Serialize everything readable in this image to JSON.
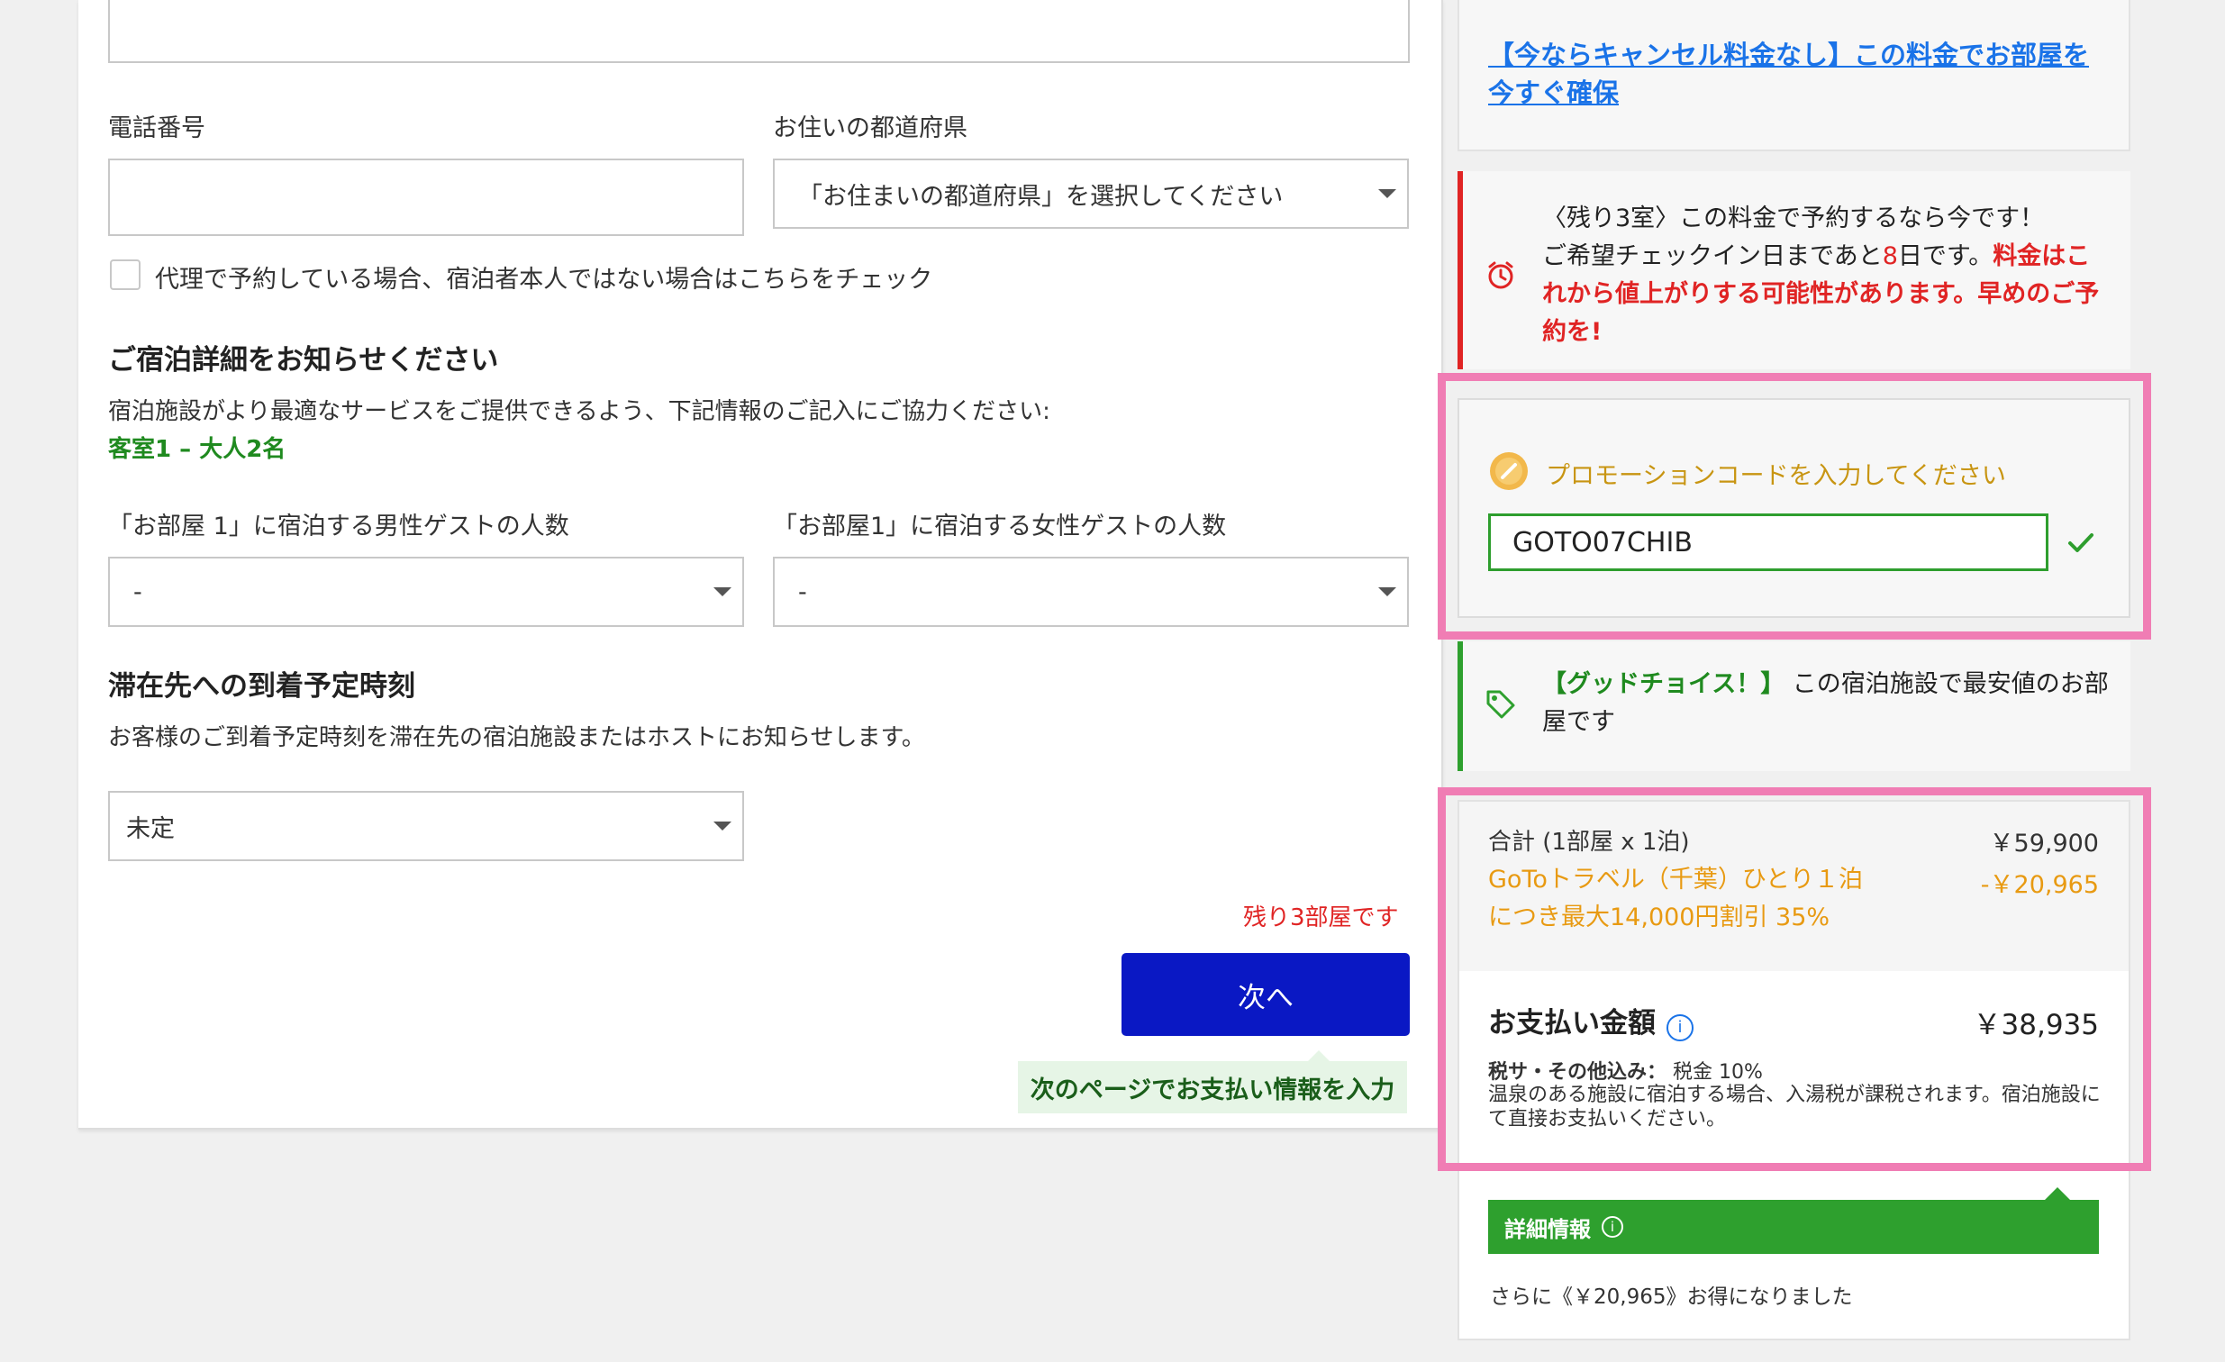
{
  "form": {
    "phone_label": "電話番号",
    "prefecture_label": "お住いの都道府県",
    "prefecture_select": "「お住まいの都道府県」を選択してください",
    "proxy_checkbox_label": "代理で予約している場合、宿泊者本人ではない場合はこちらをチェック",
    "stay_details_title": "ご宿泊詳細をお知らせください",
    "stay_details_desc": "宿泊施設がより最適なサービスをご提供できるよう、下記情報のご記入にご協力ください:",
    "room_info": "客室1 – 大人2名",
    "male_guests_label": "「お部屋 1」に宿泊する男性ゲストの人数",
    "male_guests_value": "-",
    "female_guests_label": "「お部屋1」に宿泊する女性ゲストの人数",
    "female_guests_value": "-",
    "arrival_title": "滞在先への到着予定時刻",
    "arrival_desc": "お客様のご到着予定時刻を滞在先の宿泊施設またはホストにお知らせします。",
    "arrival_value": "未定",
    "rooms_left": "残り3部屋です",
    "next_button": "次へ",
    "next_hint": "次のページでお支払い情報を入力"
  },
  "sidebar": {
    "cancel_link": "【今ならキャンセル料金なし】この料金でお部屋を今すぐ確保",
    "urgent_line1": "〈残り3室〉この料金で予約するなら今です！",
    "urgent_line2_prefix": "ご希望チェックイン日まであと",
    "urgent_days": "8",
    "urgent_line2_suffix": "日です。",
    "urgent_warning": "料金はこれから値上がりする可能性があります。早めのご予約を!",
    "promo_label": "プロモーションコードを入力してください",
    "promo_code": "GOTO07CHIB",
    "good_choice_tag": "【グッドチョイス！】",
    "good_choice_text": "この宿泊施設で最安値のお部屋です",
    "subtotal_label": "合計 (1部屋 x 1泊)",
    "subtotal_value": "￥59,900",
    "discount_label": "GoToトラベル（千葉）ひとり１泊につき最大14,000円割引 35%",
    "discount_value": "-￥20,965",
    "total_label": "お支払い金額",
    "total_value": "￥38,935",
    "tax_label": "税サ・その他込み：",
    "tax_value": "税金 10%",
    "tax_note": "温泉のある施設に宿泊する場合、入湯税が課税されます。宿泊施設にて直接お支払いください。",
    "details_label": "詳細情報",
    "savings": "さらに《￥20,965》お得になりました"
  },
  "colors": {
    "accent_blue": "#0a18c4",
    "link_blue": "#1a73e8",
    "urgent_red": "#e02424",
    "success_green": "#2ea02e",
    "promo_gold": "#c89512",
    "discount_orange": "#e89a12",
    "highlight_pink": "#f07db4"
  },
  "icons": {
    "urgent": "alarm-clock-icon",
    "promo": "coupon-icon",
    "good_choice": "price-tag-icon",
    "promo_valid": "checkmark-icon",
    "info": "info-icon"
  }
}
